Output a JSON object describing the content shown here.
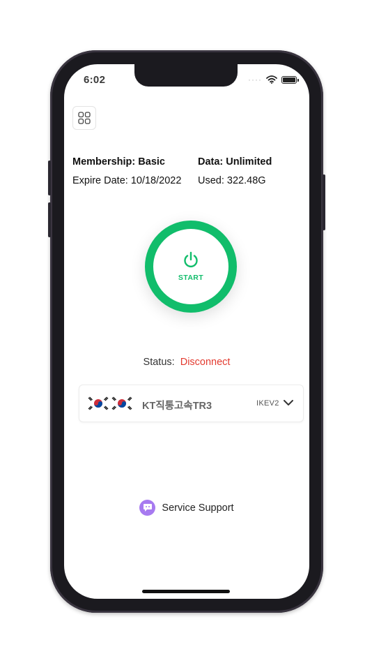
{
  "status_bar": {
    "time": "6:02"
  },
  "membership": {
    "label": "Membership:",
    "value": "Basic"
  },
  "data_plan": {
    "label": "Data:",
    "value": "Unlimited"
  },
  "expire": {
    "label": "Expire Date:",
    "value": "10/18/2022"
  },
  "used": {
    "label": "Used:",
    "value": "322.48G"
  },
  "start_button": {
    "label": "START"
  },
  "status": {
    "label": "Status:",
    "value": "Disconnect"
  },
  "server": {
    "name": "KT직통고속TR3",
    "protocol": "IKEV2",
    "flags": [
      "korea-flag-icon",
      "korea-flag-icon"
    ]
  },
  "support": {
    "label": "Service Support"
  },
  "colors": {
    "accent_green": "#11bd6b",
    "status_red": "#e33b30",
    "support_purple": "#a77af0"
  }
}
